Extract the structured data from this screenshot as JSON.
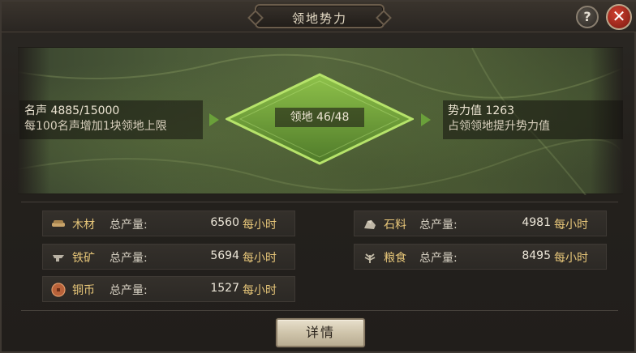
{
  "window": {
    "title": "领地势力"
  },
  "buttons": {
    "help": "?",
    "close": "✕",
    "details": "详情"
  },
  "reputation": {
    "line1": "名声 4885/15000",
    "line2": "每100名声增加1块领地上限"
  },
  "territory": {
    "label": "领地 46/48"
  },
  "power": {
    "line1": "势力值 1263",
    "line2": "占领领地提升势力值"
  },
  "resources": [
    {
      "icon": "wood-icon",
      "name": "木材",
      "label": "总产量:",
      "value": "6560",
      "unit": "每小时"
    },
    {
      "icon": "stone-icon",
      "name": "石料",
      "label": "总产量:",
      "value": "4981",
      "unit": "每小时"
    },
    {
      "icon": "iron-icon",
      "name": "铁矿",
      "label": "总产量:",
      "value": "5694",
      "unit": "每小时"
    },
    {
      "icon": "grain-icon",
      "name": "粮食",
      "label": "总产量:",
      "value": "8495",
      "unit": "每小时"
    },
    {
      "icon": "copper-coin-icon",
      "name": "铜币",
      "label": "总产量:",
      "value": "1527",
      "unit": "每小时"
    }
  ],
  "colors": {
    "accent_gold": "#e9c87a",
    "territory_green": "#7fbf3f",
    "close_red": "#c0392b"
  }
}
